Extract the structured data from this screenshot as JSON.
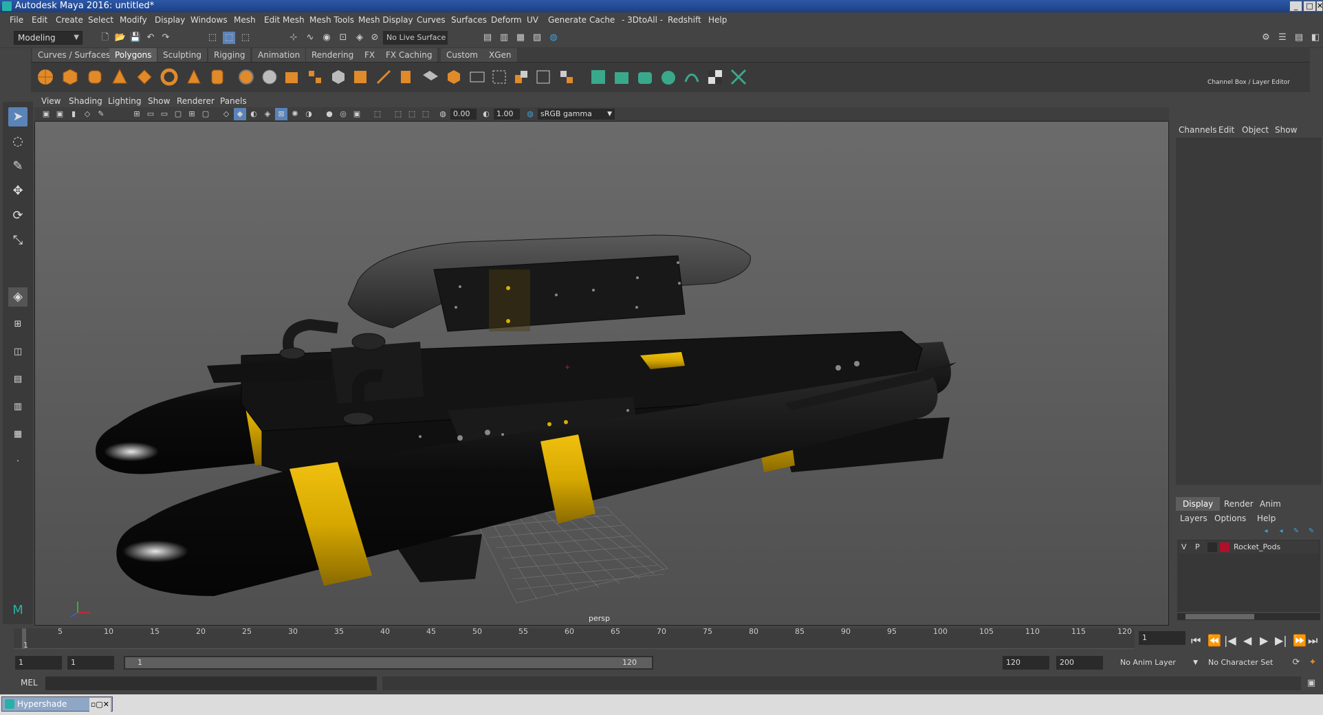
{
  "window": {
    "title": "Autodesk Maya 2016: untitled*",
    "controls": [
      "_",
      "□",
      "✕"
    ]
  },
  "menubar": {
    "items": [
      "File",
      "Edit",
      "Create",
      "Select",
      "Modify",
      "Display",
      "Windows",
      "Mesh",
      "Edit Mesh",
      "Mesh Tools",
      "Mesh Display",
      "Curves",
      "Surfaces",
      "Deform",
      "UV",
      "Generate",
      "Cache",
      "- 3DtoAll -",
      "Redshift",
      "Help"
    ]
  },
  "statusline": {
    "mode": "Modeling",
    "live_surface": "No Live Surface"
  },
  "shelf": {
    "tabs": [
      "Curves / Surfaces",
      "Polygons",
      "Sculpting",
      "Rigging",
      "Animation",
      "Rendering",
      "FX",
      "FX Caching",
      "Custom",
      "XGen"
    ],
    "active_tab": "Polygons"
  },
  "panel": {
    "menu": [
      "View",
      "Shading",
      "Lighting",
      "Show",
      "Renderer",
      "Panels"
    ],
    "exposure": "0.00",
    "gamma": "1.00",
    "color_space": "sRGB gamma",
    "camera_label": "persp"
  },
  "channel_box": {
    "title": "Channel Box / Layer Editor",
    "menu": [
      "Channels",
      "Edit",
      "Object",
      "Show"
    ]
  },
  "layer_editor": {
    "tabs": [
      "Display",
      "Render",
      "Anim"
    ],
    "active_tab": "Display",
    "menu": [
      "Layers",
      "Options",
      "Help"
    ],
    "layers": [
      {
        "visible": "V",
        "playback": "P",
        "color": "#b0102a",
        "name": "Rocket_Pods"
      }
    ]
  },
  "timeslider": {
    "ticks": [
      "1",
      "5",
      "10",
      "15",
      "20",
      "25",
      "30",
      "35",
      "40",
      "45",
      "50",
      "55",
      "60",
      "65",
      "70",
      "75",
      "80",
      "85",
      "90",
      "95",
      "100",
      "105",
      "110",
      "115",
      "120"
    ],
    "current_frame": "1"
  },
  "rangeslider": {
    "start": "1",
    "anim_start": "1",
    "range_start_label": "1",
    "range_end_label": "120",
    "end": "120",
    "anim_end": "200",
    "anim_layer": "No Anim Layer",
    "character_set": "No Character Set"
  },
  "cmdline": {
    "label": "MEL"
  },
  "taskbar": {
    "item": "Hypershade"
  },
  "colors": {
    "accent": "#5a83b8",
    "pod_yellow": "#e0b000",
    "pod_black": "#0d0d0d"
  }
}
